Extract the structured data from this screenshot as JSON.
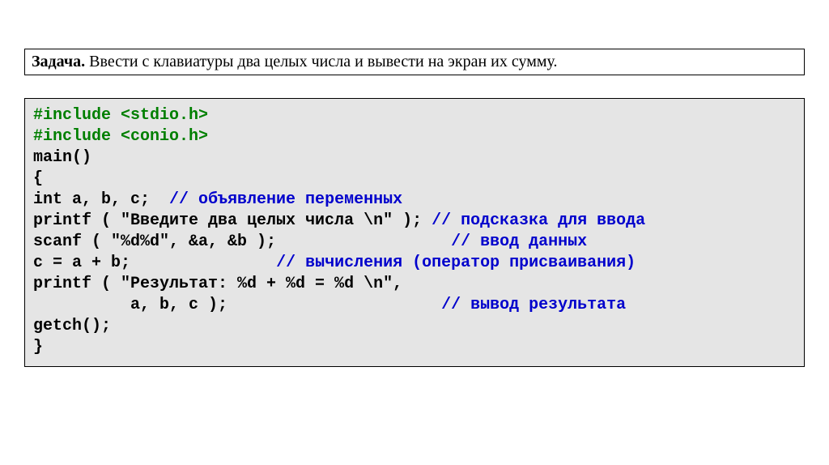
{
  "task": {
    "label": "Задача.",
    "text": " Ввести с клавиатуры два целых числа и вывести на экран их сумму."
  },
  "code": {
    "l1a": "#include <stdio.h>",
    "l2a": "#include <conio.h>",
    "l3a": "main()",
    "l4a": "{",
    "l5a": "int a, b, c;  ",
    "l5b": "// объявление переменных",
    "l6a": "printf ( \"Введите два целых числа \\n\" ); ",
    "l6b": "// подсказка для ввода",
    "l7a": "scanf ( \"%d%d\", &a, &b );                  ",
    "l7b": "// ввод данных",
    "l8a": "c = a + b;               ",
    "l8b": "// вычисления (оператор присваивания)",
    "l9a": "printf ( \"Результат: %d + %d = %d \\n\",",
    "l10a": "          a, b, c );                      ",
    "l10b": "// вывод результата",
    "l11a": "getch();",
    "l12a": "}"
  }
}
